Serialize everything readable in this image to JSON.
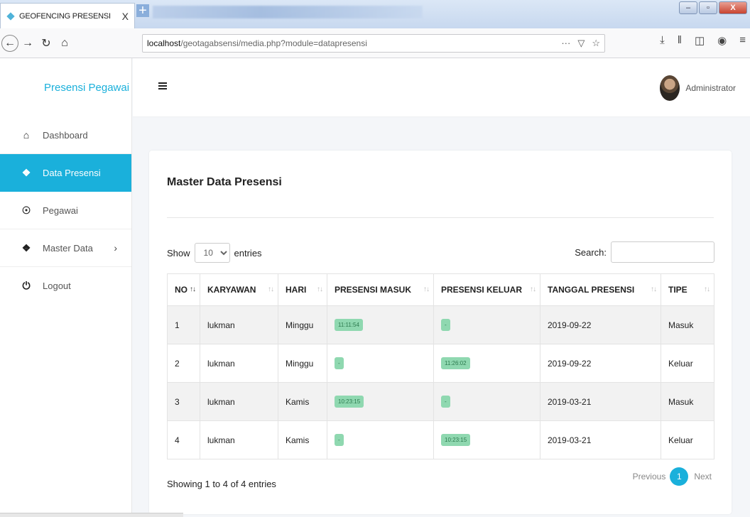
{
  "browser": {
    "tab_title": "GEOFENCING PRESENSI",
    "tab_close": "X",
    "new_tab": "+",
    "url_host": "localhost",
    "url_path": "/geotagabsensi/media.php?module=datapresensi",
    "url_more": "···",
    "window_buttons": [
      "–",
      "▫",
      "X"
    ]
  },
  "sidebar": {
    "brand": "Presensi Pegawai Pu",
    "items": [
      {
        "label": "Dashboard",
        "icon": "home-icon"
      },
      {
        "label": "Data Presensi",
        "icon": "box-icon",
        "active": true
      },
      {
        "label": "Pegawai",
        "icon": "user-icon"
      },
      {
        "label": "Master Data",
        "icon": "box-icon",
        "chevron": "›"
      },
      {
        "label": "Logout",
        "icon": "power-icon"
      }
    ]
  },
  "header": {
    "username": "Administrator"
  },
  "main": {
    "title": "Master Data Presensi",
    "show_label": "Show",
    "entries_value": "10",
    "entries_label": "entries",
    "search_label": "Search:",
    "columns": [
      "NO",
      "KARYAWAN",
      "HARI",
      "PRESENSI MASUK",
      "PRESENSI KELUAR",
      "TANGGAL PRESENSI",
      "TIPE"
    ],
    "rows": [
      {
        "no": "1",
        "karyawan": "lukman",
        "hari": "Minggu",
        "masuk": "11:11:54",
        "keluar": "-",
        "tanggal": "2019-09-22",
        "tipe": "Masuk"
      },
      {
        "no": "2",
        "karyawan": "lukman",
        "hari": "Minggu",
        "masuk": "-",
        "keluar": "11:26:02",
        "tanggal": "2019-09-22",
        "tipe": "Keluar"
      },
      {
        "no": "3",
        "karyawan": "lukman",
        "hari": "Kamis",
        "masuk": "10:23:15",
        "keluar": "-",
        "tanggal": "2019-03-21",
        "tipe": "Masuk"
      },
      {
        "no": "4",
        "karyawan": "lukman",
        "hari": "Kamis",
        "masuk": "-",
        "keluar": "10:23:15",
        "tanggal": "2019-03-21",
        "tipe": "Keluar"
      }
    ],
    "info": "Showing 1 to 4 of 4 entries",
    "pagination": {
      "previous": "Previous",
      "current": "1",
      "next": "Next"
    }
  },
  "colors": {
    "accent": "#1ab0db",
    "badge": "#8fd8b0"
  }
}
